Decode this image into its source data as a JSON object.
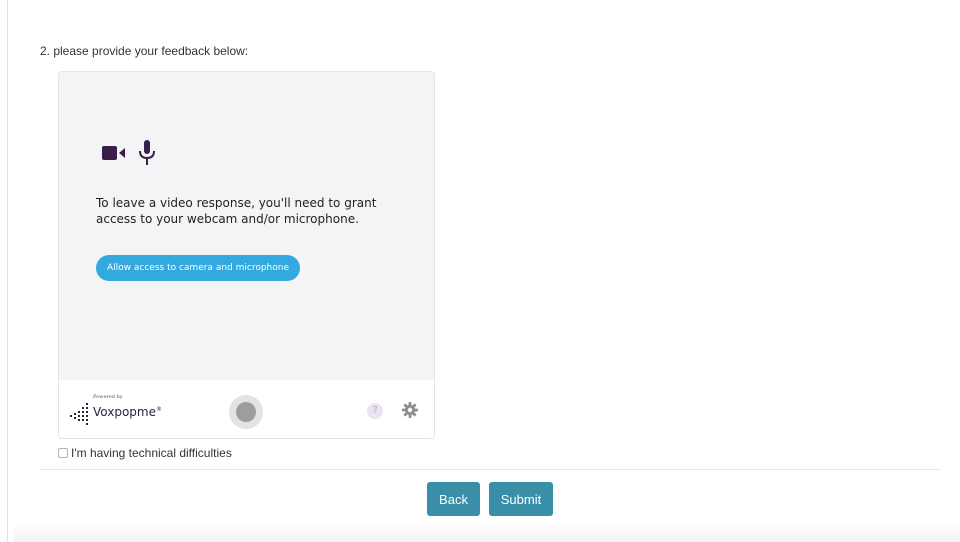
{
  "question": {
    "label": "2. please provide your feedback below:"
  },
  "recorder": {
    "icons": [
      "video-camera-icon",
      "microphone-icon"
    ],
    "access_message": "To leave a video response, you'll need to grant access to your webcam and/or microphone.",
    "access_button_label": "Allow access to camera and microphone",
    "powered_by": "Powered by",
    "brand_name": "Voxpopme",
    "brand_mark": "®",
    "help_icon_glyph": "?",
    "colors": {
      "icon": "#3b1f4a",
      "accent_button": "#33a9e0",
      "body_background": "#f3f4f6"
    }
  },
  "technical_difficulties": {
    "label": "I'm having technical difficulties",
    "checked": false
  },
  "navigation": {
    "back_label": "Back",
    "submit_label": "Submit",
    "button_color": "#3a8fa8"
  }
}
